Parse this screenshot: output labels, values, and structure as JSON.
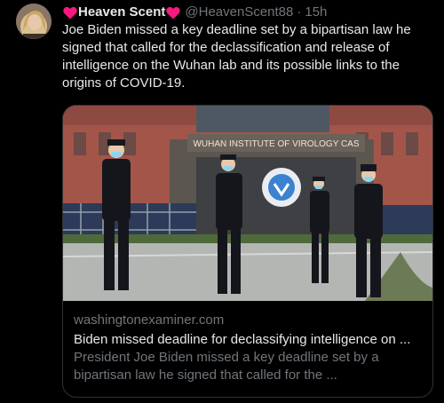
{
  "tweet": {
    "display_name": "Heaven Scent",
    "handle": "@HeavenScent88",
    "separator": "·",
    "time": "15h",
    "text": "Joe Biden missed a key deadline set by a bipartisan law he signed that called for the declassification and release of intelligence on the Wuhan lab and its possible links to the origins of COVID-19."
  },
  "card": {
    "photo_sign_text": "WUHAN INSTITUTE OF VIROLOGY CAS",
    "domain": "washingtonexaminer.com",
    "title": "Biden missed deadline for declassifying intelligence on ...",
    "description": "President Joe Biden missed a key deadline set by a bipartisan law he signed that called for the ..."
  },
  "colors": {
    "background": "#000000",
    "text_primary": "#e7e9ea",
    "text_secondary": "#71767b",
    "heart": "#f91880",
    "card_border": "#2f3336"
  },
  "icons": {
    "heart_left": "red-heart-icon",
    "heart_right": "red-heart-icon"
  }
}
